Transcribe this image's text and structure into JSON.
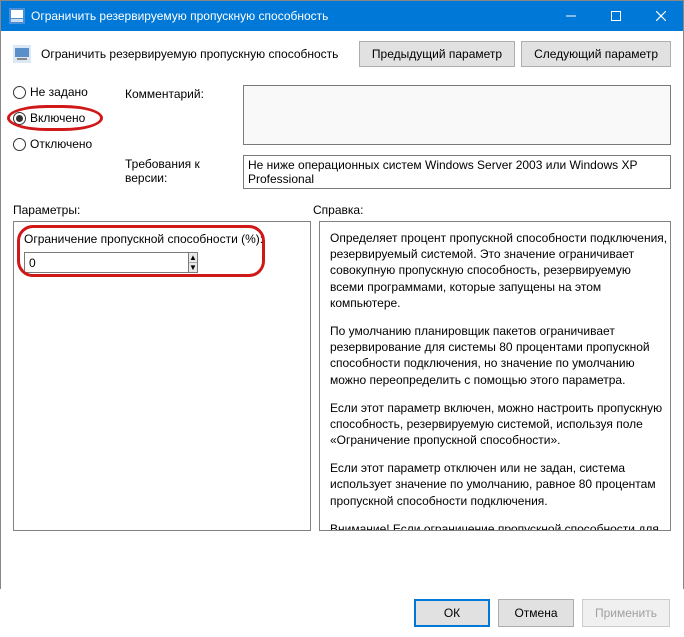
{
  "titlebar": {
    "title": "Ограничить резервируемую пропускную способность"
  },
  "header": {
    "title": "Ограничить резервируемую пропускную способность",
    "prev": "Предыдущий параметр",
    "next": "Следующий параметр"
  },
  "radios": {
    "not_set": "Не задано",
    "enabled": "Включено",
    "disabled": "Отключено",
    "selected": "enabled"
  },
  "fields": {
    "comment_label": "Комментарий:",
    "comment_value": "",
    "requirements_label": "Требования к версии:",
    "requirements_value": "Не ниже операционных систем Windows Server 2003 или Windows XP Professional"
  },
  "sections": {
    "params_label": "Параметры:",
    "help_label": "Справка:"
  },
  "params": {
    "bandwidth_label": "Ограничение пропускной способности (%):",
    "bandwidth_value": "0"
  },
  "help": {
    "p1": "Определяет процент пропускной способности подключения, резервируемый системой. Это значение ограничивает совокупную пропускную способность, резервируемую всеми программами, которые запущены на этом компьютере.",
    "p2": "По умолчанию планировщик пакетов ограничивает резервирование для системы 80 процентами пропускной способности подключения, но значение по умолчанию можно переопределить с помощью этого параметра.",
    "p3": "Если этот параметр включен, можно настроить пропускную способность, резервируемую системой, используя поле «Ограничение пропускной способности».",
    "p4": "Если этот параметр отключен или не задан, система использует значение по умолчанию, равное 80 процентам пропускной способности подключения.",
    "p5": "Внимание! Если ограничение пропускной способности для"
  },
  "footer": {
    "ok": "ОК",
    "cancel": "Отмена",
    "apply": "Применить"
  }
}
